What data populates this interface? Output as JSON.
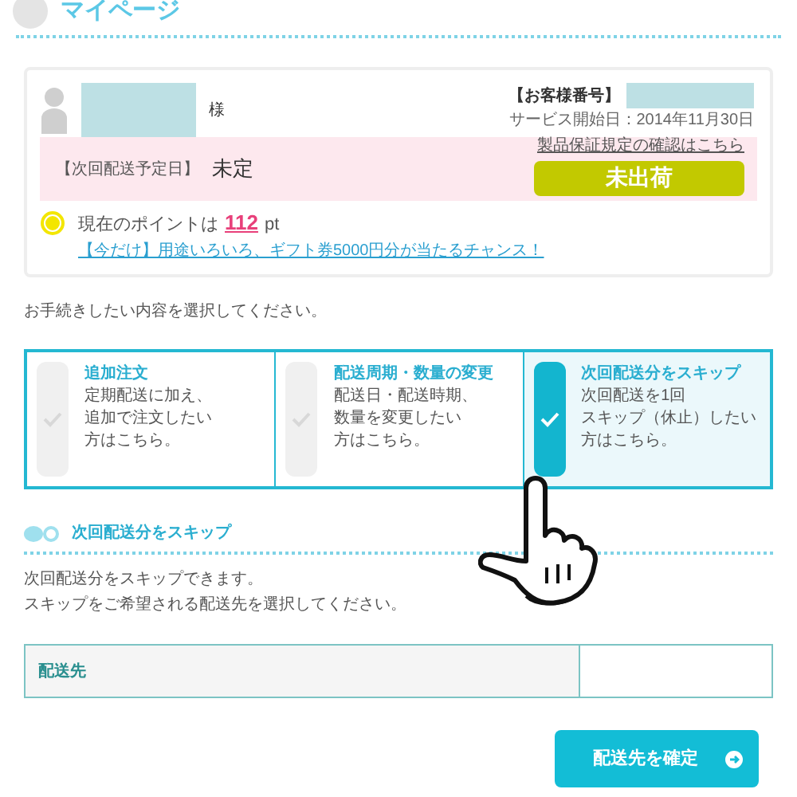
{
  "header": {
    "title": "マイページ"
  },
  "account": {
    "honorific": "様",
    "customer_number_label": "【お客様番号】",
    "service_start": "サービス開始日：2014年11月30日",
    "warranty_link": "製品保証規定の確認はこちら",
    "next_delivery_label": "【次回配送予定日】",
    "next_delivery_value": "未定",
    "shipping_status": "未出荷",
    "points_prefix": "現在のポイントは",
    "points_value": "112",
    "points_suffix": "pt",
    "campaign_link": "【今だけ】用途いろいろ、ギフト券5000円分が当たるチャンス！"
  },
  "instruction": "お手続きしたい内容を選択してください。",
  "options": [
    {
      "title": "追加注文",
      "lines": [
        "定期配送に加え、",
        "追加で注文したい",
        "方はこちら。"
      ],
      "selected": false
    },
    {
      "title": "配送周期・数量の変更",
      "lines": [
        "配送日・配送時期、",
        "数量を変更したい",
        "方はこちら。"
      ],
      "selected": false
    },
    {
      "title": "次回配送分をスキップ",
      "lines": [
        "次回配送を1回",
        "スキップ（休止）したい",
        "方はこちら。"
      ],
      "selected": true
    }
  ],
  "section": {
    "title": "次回配送分をスキップ",
    "lines": [
      "次回配送分をスキップできます。",
      "スキップをご希望される配送先を選択してください。"
    ]
  },
  "table": {
    "label": "配送先"
  },
  "confirm_button": "配送先を確定"
}
